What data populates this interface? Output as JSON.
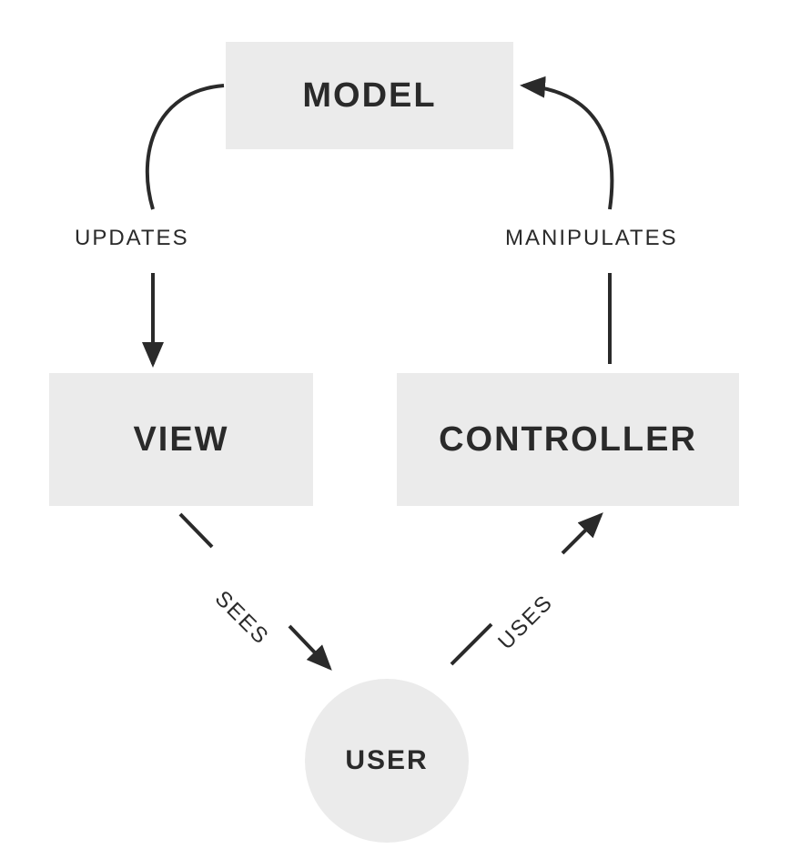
{
  "nodes": {
    "model": "MODEL",
    "view": "VIEW",
    "controller": "CONTROLLER",
    "user": "USER"
  },
  "edges": {
    "model_to_view": "UPDATES",
    "controller_to_model": "MANIPULATES",
    "view_to_user": "SEES",
    "user_to_controller": "USES"
  },
  "colors": {
    "box_bg": "#ebebeb",
    "text": "#2a2a2a",
    "arrow": "#2a2a2a"
  }
}
